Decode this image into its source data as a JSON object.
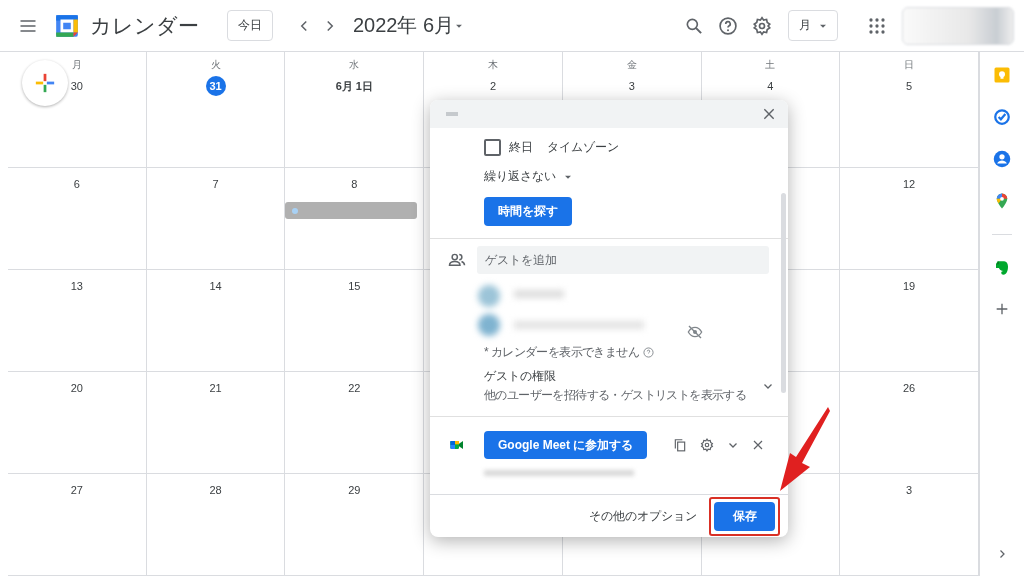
{
  "header": {
    "app_title": "カレンダー",
    "today_button": "今日",
    "month_label": "2022年 6月",
    "view_button": "月"
  },
  "weekdays": [
    "月",
    "火",
    "水",
    "木",
    "金",
    "土",
    "日"
  ],
  "weeks": [
    {
      "days": [
        {
          "date": "30",
          "today": false,
          "event": false
        },
        {
          "date": "31",
          "today": true,
          "event": false
        },
        {
          "date": "6月 1日",
          "today": false,
          "event": false
        },
        {
          "date": "2",
          "today": false,
          "event": false
        },
        {
          "date": "3",
          "today": false,
          "event": false
        },
        {
          "date": "4",
          "today": false,
          "event": false
        },
        {
          "date": "5",
          "today": false,
          "event": false
        }
      ]
    },
    {
      "days": [
        {
          "date": "6",
          "today": false,
          "event": false
        },
        {
          "date": "7",
          "today": false,
          "event": false
        },
        {
          "date": "8",
          "today": false,
          "event": true
        }
      ],
      "days_end": [
        {
          "date": "12",
          "today": false,
          "event": false
        }
      ]
    },
    {
      "days": [
        {
          "date": "13",
          "today": false,
          "event": false
        },
        {
          "date": "14",
          "today": false,
          "event": false
        },
        {
          "date": "15",
          "today": false,
          "event": false
        }
      ],
      "days_end": [
        {
          "date": "19",
          "today": false,
          "event": false
        }
      ]
    },
    {
      "days": [
        {
          "date": "20",
          "today": false,
          "event": false
        },
        {
          "date": "21",
          "today": false,
          "event": false
        },
        {
          "date": "22",
          "today": false,
          "event": false
        }
      ],
      "days_end": [
        {
          "date": "26",
          "today": false,
          "event": false
        }
      ]
    },
    {
      "days": [
        {
          "date": "27",
          "today": false,
          "event": false
        },
        {
          "date": "28",
          "today": false,
          "event": false
        },
        {
          "date": "29",
          "today": false,
          "event": false
        }
      ],
      "days_end": [
        {
          "date": "3",
          "today": false,
          "event": false
        }
      ]
    }
  ],
  "dialog": {
    "all_day": {
      "label": "終日",
      "checked": false
    },
    "timezone": "タイムゾーン",
    "repeat": "繰り返さない",
    "find_time_button": "時間を探す",
    "guest_field": {
      "placeholder": "ゲストを追加"
    },
    "calendar_note": "* カレンダーを表示できません",
    "guest_permissions": {
      "title": "ゲストの権限",
      "subtitle": "他のユーザーを招待する・ゲストリストを表示する"
    },
    "meet_button": "Google Meet に参加する",
    "more_options": "その他のオプション",
    "save_button": "保存"
  }
}
